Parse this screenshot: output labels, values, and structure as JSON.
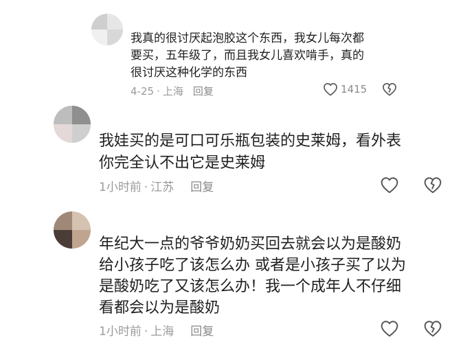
{
  "comments": [
    {
      "text": "我真的很讨厌起泡胶这个东西，我女儿每次都\n要买，五年级了，而且我女儿喜欢啃手，真的\n很讨厌这种化学的东西",
      "date": "4-25",
      "location": "上海",
      "reply_label": "回复",
      "like_count": "1415"
    },
    {
      "text": "我娃买的是可口可乐瓶包装的史莱姆，看外表\n你完全认不出它是史莱姆",
      "date": "1小时前",
      "location": "江苏",
      "reply_label": "回复"
    },
    {
      "text": "年纪大一点的爷爷奶奶买回去就会以为是酸奶\n给小孩子吃了该怎么办 或者是小孩子买了以为\n是酸奶吃了又该怎么办！我一个成年人不仔细\n看都会以为是酸奶",
      "date": "1小时前",
      "location": "上海",
      "reply_label": "回复"
    }
  ],
  "icons": {
    "like": "heart-outline-icon",
    "dislike": "broken-heart-icon"
  },
  "colors": {
    "text": "#1f1f1f",
    "meta": "#9a9a9a",
    "icon": "#555555"
  }
}
